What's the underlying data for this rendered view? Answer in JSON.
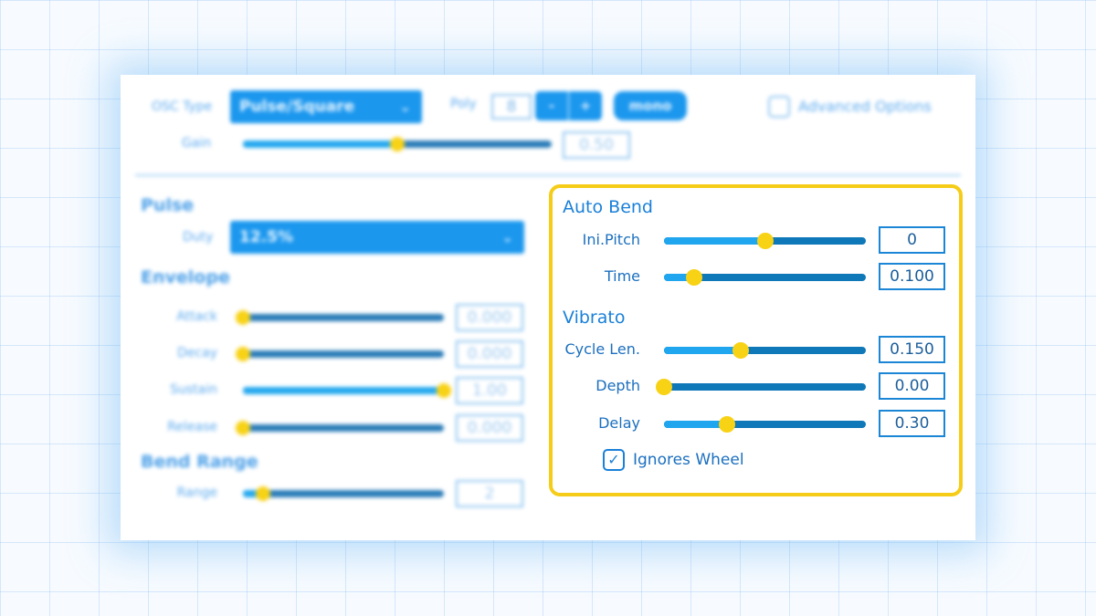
{
  "top": {
    "osc_type_label": "OSC Type",
    "osc_type_value": "Pulse/Square",
    "poly_label": "Poly",
    "poly_value": "8",
    "poly_minus": "-",
    "poly_plus": "+",
    "mono_label": "mono",
    "advanced_label": "Advanced Options",
    "gain_label": "Gain",
    "gain_value": "0.50",
    "gain_level": 0.5
  },
  "pulse": {
    "heading": "Pulse",
    "duty_label": "Duty",
    "duty_value": "12.5%"
  },
  "envelope": {
    "heading": "Envelope",
    "rows": [
      {
        "label": "Attack",
        "value": "0.000",
        "level": 0.0
      },
      {
        "label": "Decay",
        "value": "0.000",
        "level": 0.0
      },
      {
        "label": "Sustain",
        "value": "1.00",
        "level": 1.0
      },
      {
        "label": "Release",
        "value": "0.000",
        "level": 0.0
      }
    ]
  },
  "bend_range": {
    "heading": "Bend Range",
    "range_label": "Range",
    "range_value": "2",
    "level": 0.1
  },
  "auto_bend": {
    "heading": "Auto Bend",
    "rows": [
      {
        "label": "Ini.Pitch",
        "value": "0",
        "level": 0.5
      },
      {
        "label": "Time",
        "value": "0.100",
        "level": 0.15
      }
    ]
  },
  "vibrato": {
    "heading": "Vibrato",
    "rows": [
      {
        "label": "Cycle Len.",
        "value": "0.150",
        "level": 0.38
      },
      {
        "label": "Depth",
        "value": "0.00",
        "level": 0.0
      },
      {
        "label": "Delay",
        "value": "0.30",
        "level": 0.31
      }
    ],
    "ignores_wheel_label": "Ignores Wheel",
    "ignores_wheel_checked": true
  },
  "icons": {
    "dropdown": "chevron-down-icon",
    "check": "checkmark-icon"
  },
  "colors": {
    "accent": "#1b97ee",
    "knob": "#f8d214",
    "highlight_border": "#f5cd18"
  }
}
